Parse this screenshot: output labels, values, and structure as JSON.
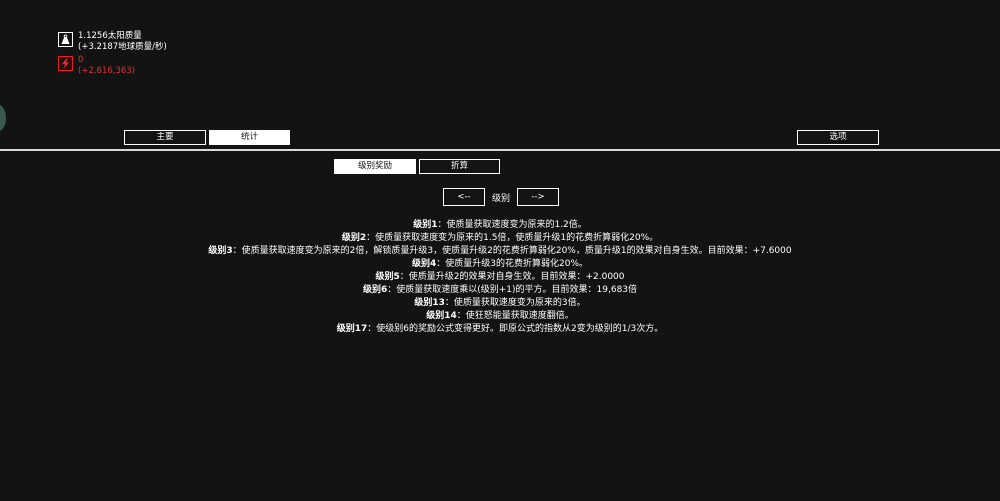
{
  "resources": {
    "mass": {
      "icon": "weight-icon",
      "amount": "1.1256太阳质量",
      "rate": "(+3.2187地球质量/秒)"
    },
    "rage": {
      "icon": "lightning-icon",
      "amount": "0",
      "rate": "(+2,616,363)",
      "color": "#e23232"
    }
  },
  "main_tabs": {
    "main": "主要",
    "stats": "统计",
    "options": "选项",
    "active": "stats"
  },
  "sub_tabs": {
    "level_rewards": "级别奖励",
    "discount": "折算",
    "active": "level_rewards"
  },
  "level_nav": {
    "prev": "<--",
    "label": "级别",
    "next": "-->"
  },
  "rewards": [
    {
      "level": "级别1",
      "text": "：使质量获取速度变为原来的1.2倍。"
    },
    {
      "level": "级别2",
      "text": "：使质量获取速度变为原来的1.5倍，使质量升级1的花费折算弱化20%。"
    },
    {
      "level": "级别3",
      "text": "：使质量获取速度变为原来的2倍，解锁质量升级3，使质量升级2的花费折算弱化20%，质量升级1的效果对自身生效。目前效果：+7.6000"
    },
    {
      "level": "级别4",
      "text": "：使质量升级3的花费折算弱化20%。"
    },
    {
      "level": "级别5",
      "text": "：使质量升级2的效果对自身生效。目前效果：+2.0000"
    },
    {
      "level": "级别6",
      "text": "：使质量获取速度乘以(级别+1)的平方。目前效果：19,683倍"
    },
    {
      "level": "级别13",
      "text": "：使质量获取速度变为原来的3倍。"
    },
    {
      "level": "级别14",
      "text": "：使狂怒能量获取速度翻倍。"
    },
    {
      "level": "级别17",
      "text": "：使级别6的奖励公式变得更好。即原公式的指数从2变为级别的1/3次方。"
    }
  ]
}
